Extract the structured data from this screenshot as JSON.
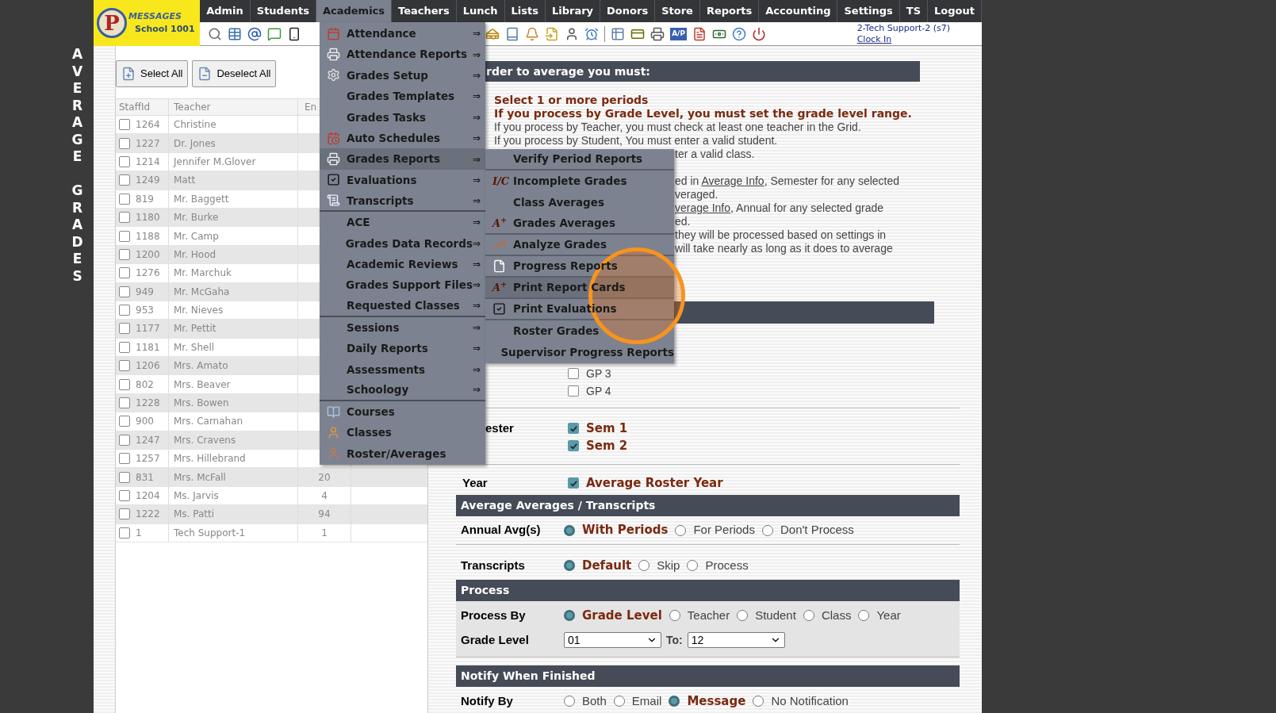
{
  "side_title": "AVERAGE GRADES",
  "logo": {
    "mark": "P",
    "name": "MESSAGES",
    "school": "School 1001"
  },
  "nav": [
    {
      "label": "Admin",
      "selected": false
    },
    {
      "label": "Students",
      "selected": false
    },
    {
      "label": "Academics",
      "selected": true
    },
    {
      "label": "Teachers",
      "selected": false
    },
    {
      "label": "Lunch",
      "selected": false
    },
    {
      "label": "Lists",
      "selected": false
    },
    {
      "label": "Library",
      "selected": false
    },
    {
      "label": "Donors",
      "selected": false
    },
    {
      "label": "Store",
      "selected": false
    },
    {
      "label": "Reports",
      "selected": false
    },
    {
      "label": "Accounting",
      "selected": false
    },
    {
      "label": "Settings",
      "selected": false
    },
    {
      "label": "TS",
      "selected": false
    },
    {
      "label": "Logout",
      "selected": false
    }
  ],
  "toolbar": {
    "badge": "A/P"
  },
  "user": {
    "name": "2-Tech Support-2 (s7)",
    "link": "Clock In"
  },
  "buttons": [
    "Select All",
    "Deselect All"
  ],
  "table": {
    "columns": [
      "StaffId",
      "Teacher",
      "En"
    ],
    "rows": [
      {
        "id": "1264",
        "teacher": "Christine",
        "checked": false
      },
      {
        "id": "1227",
        "teacher": "Dr. Jones",
        "checked": false
      },
      {
        "id": "1214",
        "teacher": "Jennifer M.Glover",
        "checked": false
      },
      {
        "id": "1249",
        "teacher": "Matt",
        "checked": false
      },
      {
        "id": "819",
        "teacher": "Mr. Baggett",
        "checked": false
      },
      {
        "id": "1180",
        "teacher": "Mr. Burke",
        "checked": false
      },
      {
        "id": "1188",
        "teacher": "Mr. Camp",
        "checked": false
      },
      {
        "id": "1200",
        "teacher": "Mr. Hood",
        "checked": false
      },
      {
        "id": "1276",
        "teacher": "Mr. Marchuk",
        "checked": false
      },
      {
        "id": "949",
        "teacher": "Mr. McGaha",
        "checked": false
      },
      {
        "id": "953",
        "teacher": "Mr. Nieves",
        "checked": false
      },
      {
        "id": "1177",
        "teacher": "Mr. Pettit",
        "checked": false
      },
      {
        "id": "1181",
        "teacher": "Mr. Shell",
        "checked": false
      },
      {
        "id": "1206",
        "teacher": "Mrs. Amato",
        "checked": false
      },
      {
        "id": "802",
        "teacher": "Mrs. Beaver",
        "checked": false
      },
      {
        "id": "1228",
        "teacher": "Mrs. Bowen",
        "checked": false
      },
      {
        "id": "900",
        "teacher": "Mrs. Carnahan",
        "checked": false
      },
      {
        "id": "1247",
        "teacher": "Mrs. Cravens",
        "checked": false
      },
      {
        "id": "1257",
        "teacher": "Mrs. Hillebrand",
        "checked": false
      },
      {
        "id": "831",
        "teacher": "Mrs. McFall",
        "count": "20",
        "checked": false
      },
      {
        "id": "1204",
        "teacher": "Ms. Jarvis",
        "count": "4",
        "checked": false
      },
      {
        "id": "1222",
        "teacher": "Ms. Patti",
        "count": "94",
        "checked": false
      },
      {
        "id": "1",
        "teacher": "Tech Support-1",
        "count": "1",
        "checked": false
      }
    ]
  },
  "menu": [
    {
      "label": "Attendance",
      "arrow": "⇒",
      "selected": false
    },
    {
      "label": "Attendance Reports",
      "arrow": "⇒",
      "selected": false
    },
    {
      "label": "Grades Setup",
      "arrow": "⇒",
      "selected": false
    },
    {
      "label": "Grades Templates",
      "arrow": "⇒",
      "selected": false
    },
    {
      "label": "Grades Tasks",
      "arrow": "⇒",
      "selected": false
    },
    {
      "label": "Auto Schedules",
      "arrow": "⇒",
      "selected": false
    },
    {
      "label": "Grades Reports",
      "arrow": "⇒",
      "selected": true
    },
    {
      "label": "Evaluations",
      "arrow": "⇒",
      "selected": false
    },
    {
      "label": "Transcripts",
      "arrow": "⇒",
      "selected": false,
      "separator_after": true
    },
    {
      "label": "ACE",
      "arrow": "⇒",
      "selected": false
    },
    {
      "label": "Grades Data Records",
      "arrow": "⇒",
      "selected": false
    },
    {
      "label": "Academic Reviews",
      "arrow": "⇒",
      "selected": false
    },
    {
      "label": "Grades Support Files",
      "arrow": "⇒",
      "selected": false
    },
    {
      "label": "Requested Classes",
      "arrow": "⇒",
      "selected": false,
      "separator_after": true
    },
    {
      "label": "Sessions",
      "arrow": "⇒",
      "selected": false
    },
    {
      "label": "Daily Reports",
      "arrow": "⇒",
      "selected": false
    },
    {
      "label": "Assessments",
      "arrow": "⇒",
      "selected": false
    },
    {
      "label": "Schoology",
      "arrow": "⇒",
      "selected": false,
      "separator_after": true
    },
    {
      "label": "Courses",
      "selected": false
    },
    {
      "label": "Classes",
      "selected": false
    },
    {
      "label": "Roster/Averages",
      "selected": false
    }
  ],
  "submenu": [
    {
      "label": "Verify Period Reports",
      "selected": false,
      "separator_after": true
    },
    {
      "label": "Incomplete Grades",
      "glyph": "I/C",
      "selected": false
    },
    {
      "label": "Class Averages",
      "selected": false
    },
    {
      "label": "Grades Averages",
      "glyph": "A$^{+}$",
      "selected": false,
      "separator_after": true
    },
    {
      "label": "Analyze Grades",
      "selected": false,
      "separator_after": true
    },
    {
      "label": "Progress Reports",
      "selected": false,
      "separator_after": true
    },
    {
      "label": "Print Report Cards",
      "glyph": "A$^{+}$",
      "selected": true,
      "separator_after": true
    },
    {
      "label": "Print Evaluations",
      "selected": false,
      "separator_after": true
    },
    {
      "label": "Roster Grades",
      "selected": false
    },
    {
      "label": "Supervisor Progress Reports",
      "selected": false
    }
  ],
  "instructions": {
    "heading": "rder to average you must:",
    "lines": [
      {
        "text": "Select 1 or more periods",
        "kind": "strong"
      },
      {
        "text": "If you process by Grade Level, you must set the grade level range.",
        "kind": "strong"
      },
      {
        "text": "If you process by Teacher, you must check at least one teacher in the Grid.",
        "kind": "plain"
      },
      {
        "text": "If you process by Student, You must enter a valid student.",
        "kind": "plain"
      }
    ],
    "cut_paragraphs": [
      [
        [
          {
            "text": "ter a valid class."
          }
        ]
      ],
      [
        [
          {
            "text": "ed in "
          },
          {
            "text": "Average Info",
            "link": true
          },
          {
            "text": ", Semester for any selected"
          }
        ],
        [
          {
            "text": "veraged."
          }
        ],
        [
          {
            "text": "verage Info",
            "link": true
          },
          {
            "text": ", Annual for any selected grade"
          }
        ],
        [
          {
            "text": "ed."
          }
        ],
        [
          {
            "text": "they will be processed based on settings in"
          }
        ],
        [
          {
            "text": "will take nearly as long as it does to average"
          }
        ]
      ]
    ]
  },
  "periods": [
    {
      "label": "GP 3",
      "checked": false
    },
    {
      "label": "GP 4",
      "checked": false
    }
  ],
  "semester": {
    "label": "ester",
    "options": [
      {
        "label": "Sem 1",
        "checked": true
      },
      {
        "label": "Sem 2",
        "checked": true
      }
    ]
  },
  "year": {
    "label": "Year",
    "options": [
      {
        "label": "Average Roster Year",
        "checked": true
      }
    ]
  },
  "sections": [
    {
      "title": "Average Averages / Transcripts",
      "shaded": false,
      "rows": [
        {
          "kind": "radio",
          "label": "Annual Avg(s)",
          "divider_after": true,
          "options": [
            {
              "label": "With Periods",
              "selected": true
            },
            {
              "label": "For Periods",
              "selected": false
            },
            {
              "label": "Don't Process",
              "selected": false
            }
          ]
        },
        {
          "kind": "radio",
          "label": "Transcripts",
          "options": [
            {
              "label": "Default",
              "selected": true
            },
            {
              "label": "Skip",
              "selected": false
            },
            {
              "label": "Process",
              "selected": false
            }
          ]
        }
      ]
    },
    {
      "title": "Process",
      "shaded": true,
      "rows": [
        {
          "kind": "radio",
          "label": "Process By",
          "options": [
            {
              "label": "Grade Level",
              "selected": true
            },
            {
              "label": "Teacher",
              "selected": false
            },
            {
              "label": "Student",
              "selected": false
            },
            {
              "label": "Class",
              "selected": false
            },
            {
              "label": "Year",
              "selected": false
            }
          ]
        },
        {
          "kind": "range",
          "label": "Grade Level",
          "from": "01",
          "to_label": "To:",
          "to": "12"
        }
      ]
    },
    {
      "title": "Notify When Finished",
      "shaded": false,
      "rows": [
        {
          "kind": "radio",
          "label": "Notify By",
          "options": [
            {
              "label": "Both",
              "selected": false
            },
            {
              "label": "Email",
              "selected": false
            },
            {
              "label": "Message",
              "selected": true
            },
            {
              "label": "No Notification",
              "selected": false
            }
          ]
        }
      ]
    }
  ]
}
